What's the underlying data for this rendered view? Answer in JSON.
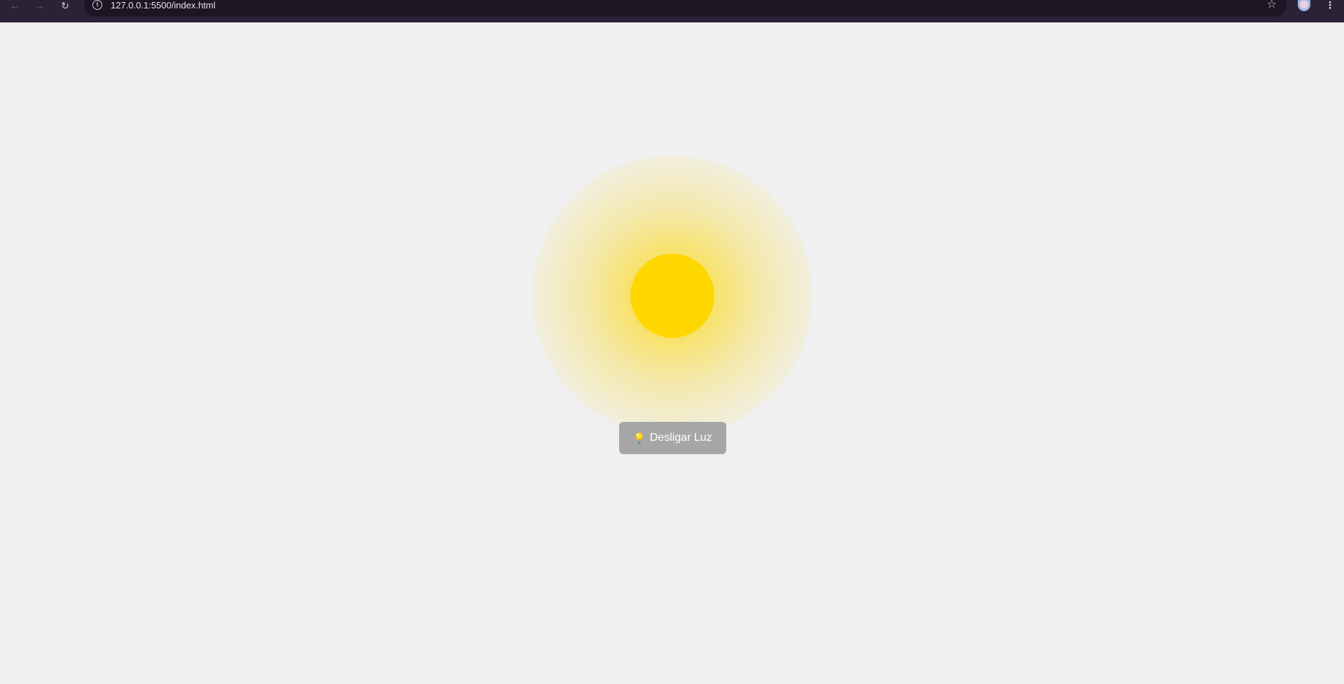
{
  "browser": {
    "url": "127.0.0.1:5500/index.html",
    "back_icon": "←",
    "forward_icon": "→",
    "reload_icon": "↻",
    "info_icon": "i",
    "bookmark_icon": "☆",
    "menu_icon": "⋮"
  },
  "page": {
    "background_color": "#f0f0f0",
    "lamp": {
      "state": "on",
      "color": "#ffd700"
    },
    "toggle_button": {
      "icon": "💡",
      "label": "Desligar Luz",
      "background_color": "#a6a6a6",
      "text_color": "#ffffff"
    }
  }
}
